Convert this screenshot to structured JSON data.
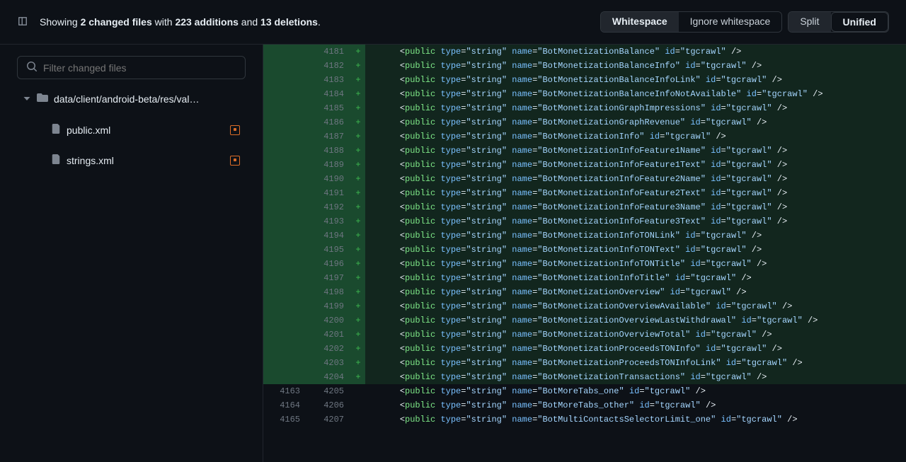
{
  "header": {
    "summary": {
      "prefix": "Showing ",
      "files_count": "2 changed files",
      "with": " with ",
      "additions": "223 additions",
      "and": " and ",
      "deletions": "13 deletions",
      "suffix": "."
    },
    "ws_active": "Whitespace",
    "ws_inactive": "Ignore whitespace",
    "view_split": "Split",
    "view_unified": "Unified"
  },
  "sidebar": {
    "filter_placeholder": "Filter changed files",
    "folder_label": "data/client/android-beta/res/val…",
    "files": [
      {
        "name": "public.xml"
      },
      {
        "name": "strings.xml"
      }
    ]
  },
  "diff": {
    "lines": [
      {
        "type": "added",
        "old": "",
        "new": "4181",
        "marker": "+",
        "name": "BotMonetizationBalance"
      },
      {
        "type": "added",
        "old": "",
        "new": "4182",
        "marker": "+",
        "name": "BotMonetizationBalanceInfo"
      },
      {
        "type": "added",
        "old": "",
        "new": "4183",
        "marker": "+",
        "name": "BotMonetizationBalanceInfoLink"
      },
      {
        "type": "added",
        "old": "",
        "new": "4184",
        "marker": "+",
        "name": "BotMonetizationBalanceInfoNotAvailable"
      },
      {
        "type": "added",
        "old": "",
        "new": "4185",
        "marker": "+",
        "name": "BotMonetizationGraphImpressions"
      },
      {
        "type": "added",
        "old": "",
        "new": "4186",
        "marker": "+",
        "name": "BotMonetizationGraphRevenue"
      },
      {
        "type": "added",
        "old": "",
        "new": "4187",
        "marker": "+",
        "name": "BotMonetizationInfo"
      },
      {
        "type": "added",
        "old": "",
        "new": "4188",
        "marker": "+",
        "name": "BotMonetizationInfoFeature1Name"
      },
      {
        "type": "added",
        "old": "",
        "new": "4189",
        "marker": "+",
        "name": "BotMonetizationInfoFeature1Text"
      },
      {
        "type": "added",
        "old": "",
        "new": "4190",
        "marker": "+",
        "name": "BotMonetizationInfoFeature2Name"
      },
      {
        "type": "added",
        "old": "",
        "new": "4191",
        "marker": "+",
        "name": "BotMonetizationInfoFeature2Text"
      },
      {
        "type": "added",
        "old": "",
        "new": "4192",
        "marker": "+",
        "name": "BotMonetizationInfoFeature3Name"
      },
      {
        "type": "added",
        "old": "",
        "new": "4193",
        "marker": "+",
        "name": "BotMonetizationInfoFeature3Text"
      },
      {
        "type": "added",
        "old": "",
        "new": "4194",
        "marker": "+",
        "name": "BotMonetizationInfoTONLink"
      },
      {
        "type": "added",
        "old": "",
        "new": "4195",
        "marker": "+",
        "name": "BotMonetizationInfoTONText"
      },
      {
        "type": "added",
        "old": "",
        "new": "4196",
        "marker": "+",
        "name": "BotMonetizationInfoTONTitle"
      },
      {
        "type": "added",
        "old": "",
        "new": "4197",
        "marker": "+",
        "name": "BotMonetizationInfoTitle"
      },
      {
        "type": "added",
        "old": "",
        "new": "4198",
        "marker": "+",
        "name": "BotMonetizationOverview"
      },
      {
        "type": "added",
        "old": "",
        "new": "4199",
        "marker": "+",
        "name": "BotMonetizationOverviewAvailable"
      },
      {
        "type": "added",
        "old": "",
        "new": "4200",
        "marker": "+",
        "name": "BotMonetizationOverviewLastWithdrawal"
      },
      {
        "type": "added",
        "old": "",
        "new": "4201",
        "marker": "+",
        "name": "BotMonetizationOverviewTotal"
      },
      {
        "type": "added",
        "old": "",
        "new": "4202",
        "marker": "+",
        "name": "BotMonetizationProceedsTONInfo"
      },
      {
        "type": "added",
        "old": "",
        "new": "4203",
        "marker": "+",
        "name": "BotMonetizationProceedsTONInfoLink"
      },
      {
        "type": "added",
        "old": "",
        "new": "4204",
        "marker": "+",
        "name": "BotMonetizationTransactions"
      },
      {
        "type": "context",
        "old": "4163",
        "new": "4205",
        "marker": "",
        "name": "BotMoreTabs_one"
      },
      {
        "type": "context",
        "old": "4164",
        "new": "4206",
        "marker": "",
        "name": "BotMoreTabs_other"
      },
      {
        "type": "context",
        "old": "4165",
        "new": "4207",
        "marker": "",
        "name": "BotMultiContactsSelectorLimit_one"
      }
    ],
    "xml": {
      "tag": "public",
      "type_attr": "type",
      "type_val": "string",
      "name_attr": "name",
      "id_attr": "id",
      "id_val": "tgcrawl"
    }
  }
}
